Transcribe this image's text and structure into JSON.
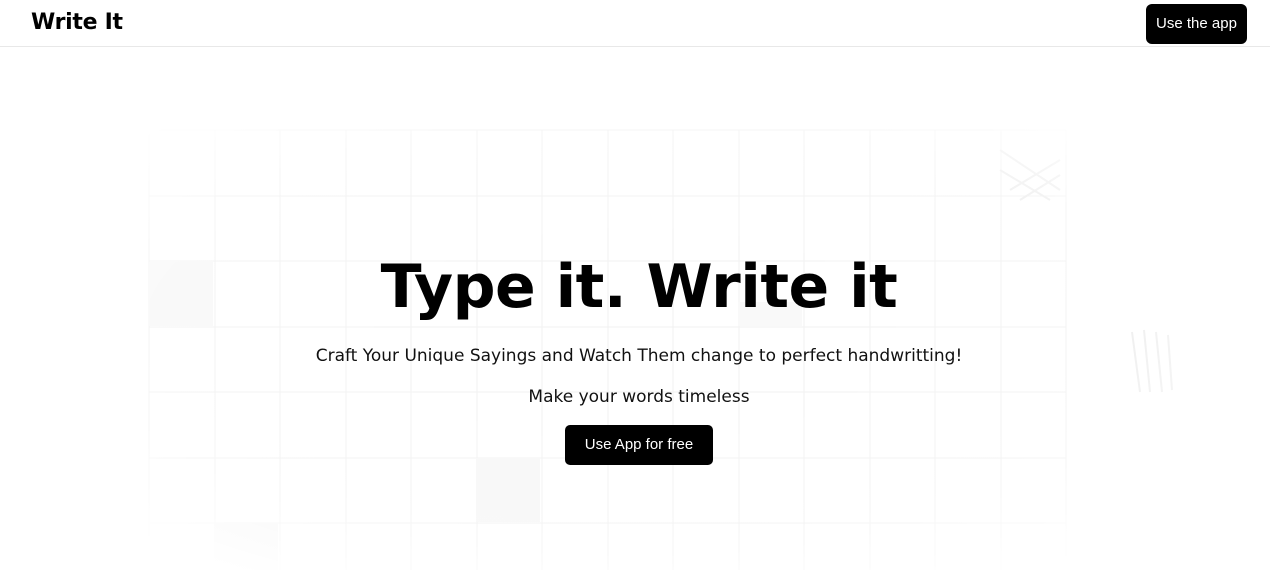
{
  "nav": {
    "brand": "Write It",
    "cta_label": "Use the app"
  },
  "hero": {
    "title": "Type it. Write it",
    "subtitle": "Craft Your Unique Sayings and Watch Them change to perfect handwritting!",
    "tagline": "Make your words timeless",
    "cta_label": "Use App for free"
  },
  "colors": {
    "primary": "#000000",
    "background": "#ffffff",
    "grid_line": "#f2f2f2"
  }
}
